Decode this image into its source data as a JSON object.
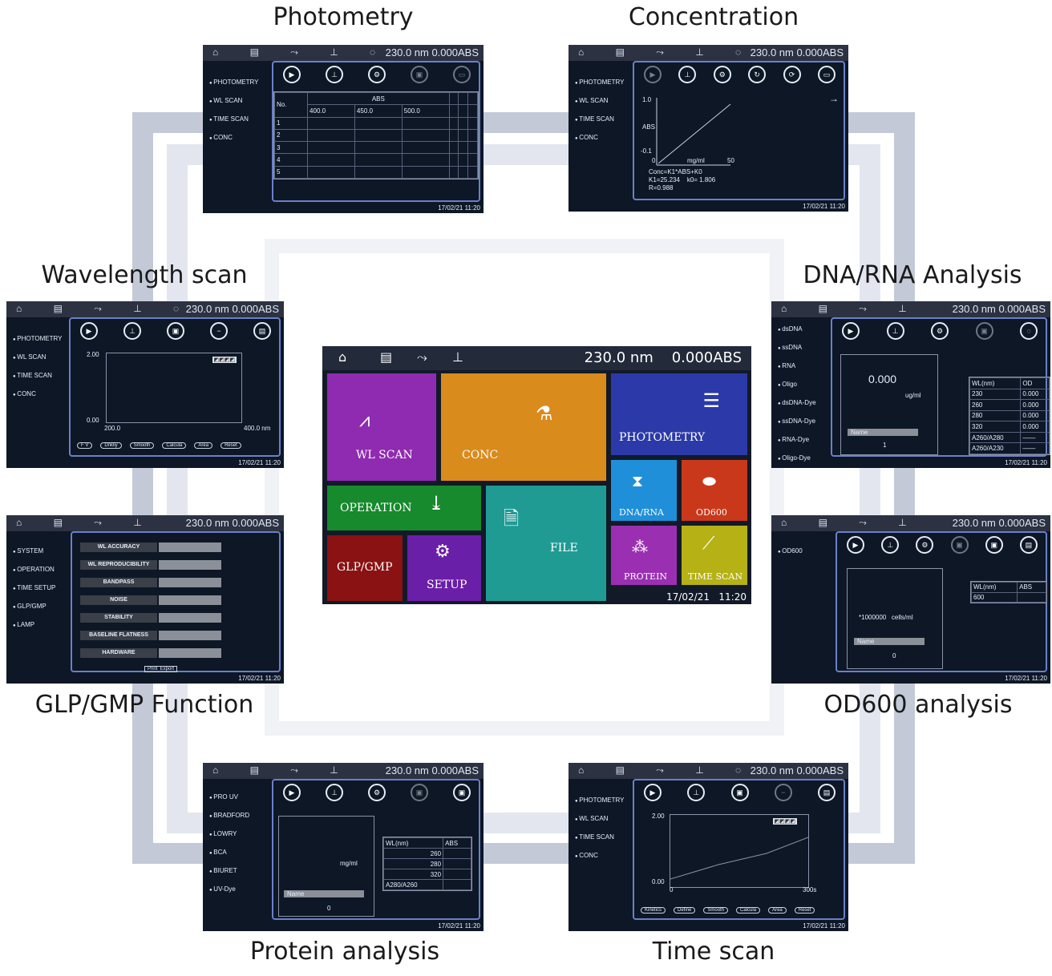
{
  "captions": {
    "photometry": "Photometry",
    "concentration": "Concentration",
    "wavelength": "Wavelength scan",
    "dna": "DNA/RNA Analysis",
    "glp": "GLP/GMP Function",
    "od600": "OD600 analysis",
    "protein": "Protein analysis",
    "timescan": "Time scan"
  },
  "status": "230.0 nm  0.000ABS",
  "datetime": "17/02/21  11:20",
  "main": {
    "status": "230.0 nm    0.000ABS",
    "datetime": "17/02/21   11:20",
    "tiles": {
      "wlscan": "WL SCAN",
      "conc": "CONC",
      "photometry": "PHOTOMETRY",
      "operation": "OPERATION",
      "file": "FILE",
      "dna": "DNA/RNA",
      "od600": "OD600",
      "glp": "GLP/GMP",
      "setup": "SETUP",
      "protein": "PROTEIN",
      "timescan": "TIME SCAN"
    },
    "colors": {
      "wlscan": "#8f2bb0",
      "conc": "#d98b1c",
      "photometry": "#2b3aa8",
      "operation": "#168a2c",
      "file": "#1f9b94",
      "dna": "#1f8fd9",
      "od600": "#c9381a",
      "glp": "#8a1212",
      "setup": "#6a1fa8",
      "protein": "#9b2fb2",
      "timescan": "#b6b114"
    }
  },
  "menus": {
    "photometry": [
      "PHOTOMETRY",
      "WL SCAN",
      "TIME SCAN",
      "CONC"
    ],
    "glp": [
      "SYSTEM",
      "OPERATION",
      "TIME SETUP",
      "GLP/GMP",
      "LAMP"
    ],
    "dna": [
      "dsDNA",
      "ssDNA",
      "RNA",
      "Oligo",
      "dsDNA-Dye",
      "ssDNA-Dye",
      "RNA-Dye",
      "Oligo-Dye"
    ],
    "od600": [
      "OD600"
    ],
    "protein": [
      "PRO UV",
      "BRADFORD",
      "LOWRY",
      "BCA",
      "BIURET",
      "UV-Dye"
    ]
  },
  "photometry_table": {
    "no": "No.",
    "abs": "ABS",
    "waves": [
      "400.0",
      "450.0",
      "500.0"
    ],
    "rows": [
      "1",
      "2",
      "3",
      "4",
      "5"
    ]
  },
  "conc": {
    "y_top": "1.0",
    "y_label": "ABS",
    "y_bottom": "-0.1",
    "x0": "0",
    "xunit": "mg/ml",
    "x1": "50",
    "formula": "Conc=K1*ABS+K0",
    "k": "K1=25.234    k0= 1.806",
    "r": "R=0.988"
  },
  "wl": {
    "ytop": "2.00",
    "ybot": "0.00",
    "x0": "200.0",
    "x1": "400.0 nm",
    "pills": [
      "F V",
      "Dnkliy",
      "Smooth",
      "Calcula",
      "Area",
      "Reset"
    ]
  },
  "glp": {
    "labels": [
      "WL ACCURACY",
      "WL REPRODUCIBILITY",
      "BANDPASS",
      "NOISE",
      "STABILITY",
      "BASELINE FLATNESS",
      "HARDWARE"
    ],
    "footer": "Print  Export"
  },
  "dna": {
    "value": "0.000",
    "unit": "ug/ml",
    "name": "Name",
    "page": "1",
    "wl_head": "WL(nm)",
    "od_head": "OD",
    "rows": [
      [
        "230",
        "0.000"
      ],
      [
        "260",
        "0.000"
      ],
      [
        "280",
        "0.000"
      ],
      [
        "320",
        "0.000"
      ],
      [
        "A260/A280",
        "——"
      ],
      [
        "A260/A230",
        "——"
      ]
    ]
  },
  "od600": {
    "value": "*1000000   cells/ml",
    "name": "Name",
    "page": "0",
    "wl_head": "WL(nm)",
    "abs_head": "ABS",
    "row": "600"
  },
  "protein": {
    "unit": "mg/ml",
    "name": "Name",
    "page": "0",
    "wl_head": "WL(nm)",
    "abs_head": "ABS",
    "rows": [
      "260",
      "280",
      "320",
      "A280/A260"
    ]
  },
  "ts": {
    "ytop": "2.00",
    "ybot": "0.00",
    "x0": "0",
    "x1": "300s",
    "pills": [
      "Kinetics",
      "Define",
      "Smooth",
      "Calcula",
      "Area",
      "Reset"
    ]
  }
}
